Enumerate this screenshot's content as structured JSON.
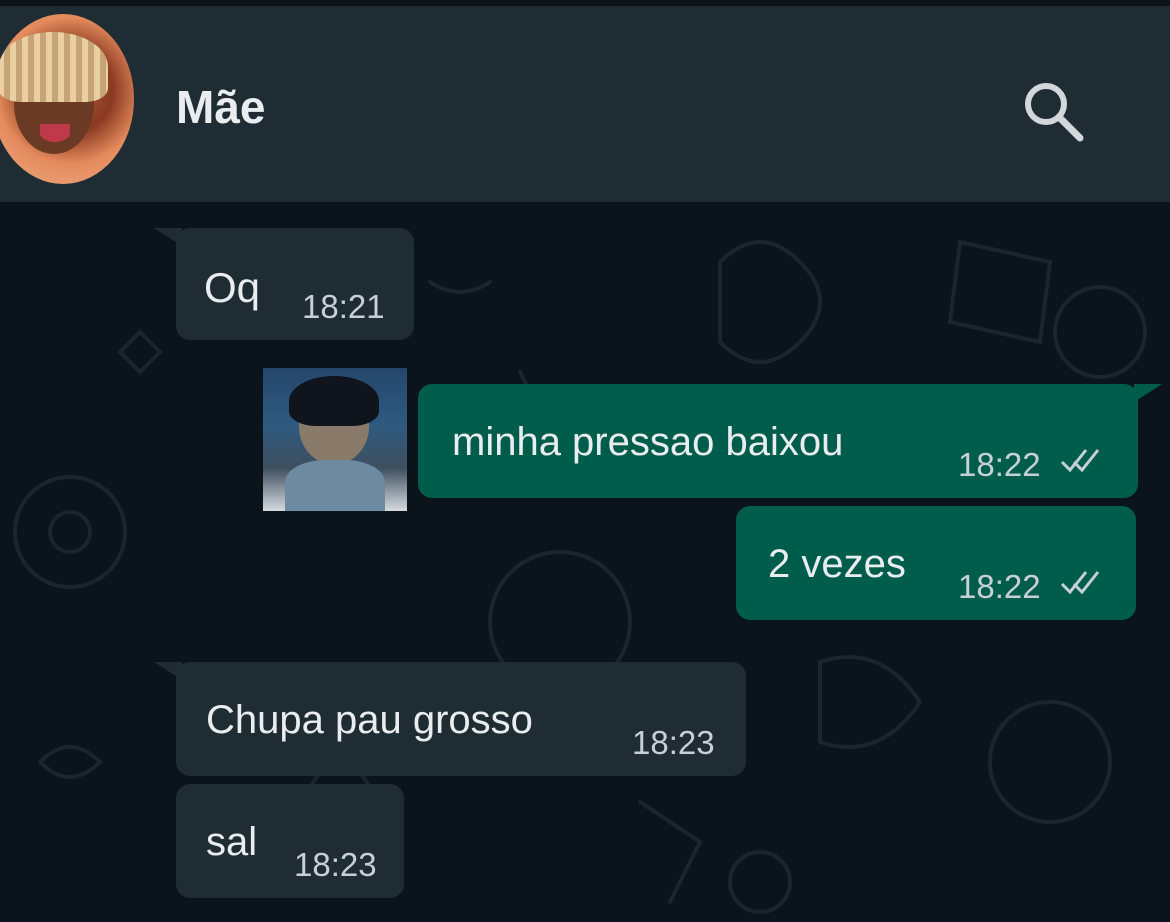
{
  "header": {
    "contact_name": "Mãe",
    "search_icon": "search-icon"
  },
  "messages": [
    {
      "direction": "incoming",
      "text": "Oq",
      "time": "18:21"
    },
    {
      "direction": "outgoing",
      "text": "minha pressao baixou",
      "time": "18:22",
      "status": "double-check-icon"
    },
    {
      "direction": "outgoing",
      "text": "2 vezes",
      "time": "18:22",
      "status": "double-check-icon"
    },
    {
      "direction": "incoming",
      "text": "Chupa pau grosso",
      "time": "18:23"
    },
    {
      "direction": "incoming",
      "text": "sal",
      "time": "18:23"
    }
  ],
  "colors": {
    "background": "#0b141a",
    "header": "#1f2c34",
    "incoming_bubble": "#1f2c34",
    "outgoing_bubble": "#005c4b",
    "text": "#e9edef"
  }
}
